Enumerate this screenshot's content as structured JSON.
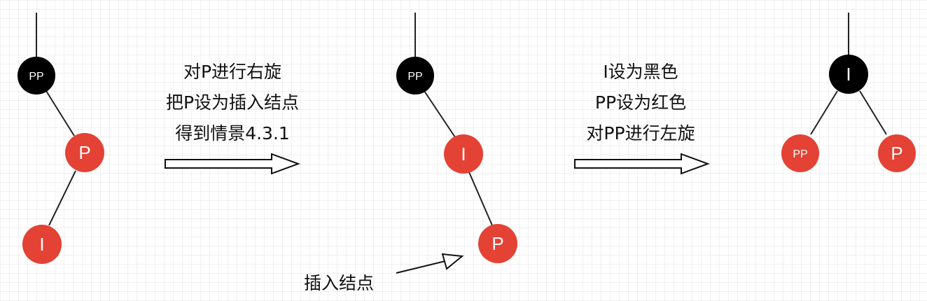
{
  "colors": {
    "black_node": "#000000",
    "red_node": "#e34234",
    "edge": "#222222",
    "text": "#111111"
  },
  "diagram_1": {
    "nodes": [
      {
        "label": "PP",
        "color": "black"
      },
      {
        "label": "P",
        "color": "red"
      },
      {
        "label": "I",
        "color": "red"
      }
    ]
  },
  "step_1": {
    "lines": [
      "对P进行右旋",
      "把P设为插入结点",
      "得到情景4.3.1"
    ]
  },
  "diagram_2": {
    "nodes": [
      {
        "label": "PP",
        "color": "black"
      },
      {
        "label": "I",
        "color": "red"
      },
      {
        "label": "P",
        "color": "red"
      }
    ],
    "annotation": "插入结点"
  },
  "step_2": {
    "lines": [
      "I设为黑色",
      "PP设为红色",
      "对PP进行左旋"
    ]
  },
  "diagram_3": {
    "nodes": [
      {
        "label": "I",
        "color": "black"
      },
      {
        "label": "PP",
        "color": "red"
      },
      {
        "label": "P",
        "color": "red"
      }
    ]
  }
}
